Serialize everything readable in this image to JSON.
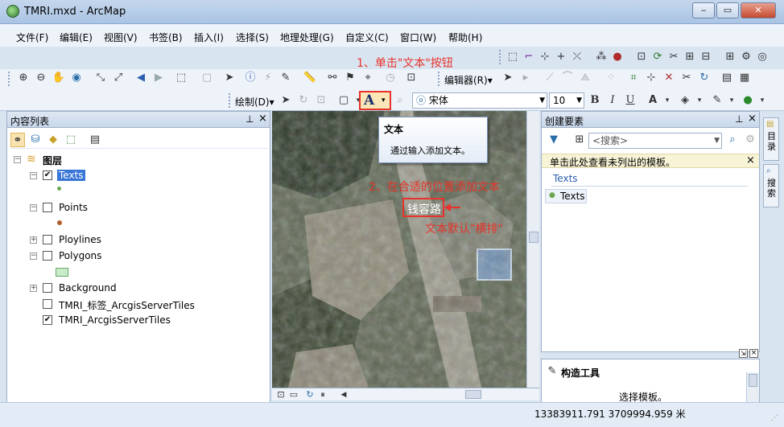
{
  "window": {
    "title": "TMRI.mxd - ArcMap"
  },
  "menu": [
    "文件(F)",
    "编辑(E)",
    "视图(V)",
    "书签(B)",
    "插入(I)",
    "选择(S)",
    "地理处理(G)",
    "自定义(C)",
    "窗口(W)",
    "帮助(H)"
  ],
  "toolbar": {
    "editor_label": "编辑器(R)▾",
    "draw_label": "绘制(D)▾",
    "font_name": "宋体",
    "font_size": "10",
    "bold": "B",
    "italic": "I",
    "underline": "U",
    "text_tool": "A"
  },
  "annotations": {
    "step1": "1、单击\"文本\"按钮",
    "step2": "2、在合适的位置添加文本",
    "note": "文本默认\"横排\""
  },
  "tooltip": {
    "title": "文本",
    "body": "通过输入添加文本。"
  },
  "map": {
    "label": "钱容路"
  },
  "toc": {
    "title": "内容列表",
    "pin": "ᵖ",
    "close": "×",
    "root": "图层",
    "layers": [
      {
        "name": "Texts",
        "checked": true,
        "expanded": true,
        "selected": true
      },
      {
        "name": "Points",
        "checked": false,
        "expanded": true
      },
      {
        "name": "Ploylines",
        "checked": false,
        "expanded": false
      },
      {
        "name": "Polygons",
        "checked": false,
        "expanded": true
      },
      {
        "name": "Background",
        "checked": false,
        "expanded": false
      },
      {
        "name": "TMRI_标签_ArcgisServerTiles",
        "checked": false
      },
      {
        "name": "TMRI_ArcgisServerTiles",
        "checked": true
      }
    ]
  },
  "create_features": {
    "title": "创建要素",
    "search_placeholder": "<搜索>",
    "hint": "单击此处查看未列出的模板。",
    "group": "Texts",
    "item": "Texts"
  },
  "construct_tools": {
    "title": "构造工具",
    "hint": "选择模板。"
  },
  "side_tabs": [
    "目录",
    "搜索"
  ],
  "status": {
    "coords": "13383911.791  3709994.959 米"
  }
}
